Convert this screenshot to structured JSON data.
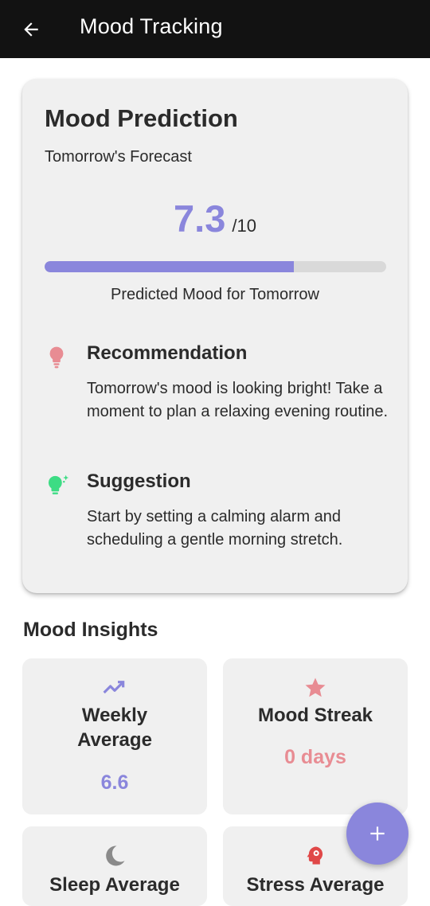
{
  "appbar": {
    "title": "Mood Tracking",
    "back_icon": "arrow-back-icon"
  },
  "prediction": {
    "title": "Mood Prediction",
    "subtitle": "Tomorrow's Forecast",
    "score": "7.3",
    "score_max": "/10",
    "progress_fraction": 0.73,
    "caption": "Predicted Mood for Tomorrow",
    "recommendation": {
      "icon": "lightbulb-icon",
      "heading": "Recommendation",
      "text": "Tomorrow's mood is looking bright! Take a moment to plan a relaxing evening routine."
    },
    "suggestion": {
      "icon": "lightbulb-sparkle-icon",
      "heading": "Suggestion",
      "text": "Start by setting a calming alarm and scheduling a gentle morning stretch."
    }
  },
  "insights": {
    "title": "Mood Insights",
    "tiles": [
      {
        "icon": "trending-up-icon",
        "label": "Weekly Average",
        "value": "6.6"
      },
      {
        "icon": "star-icon",
        "label": "Mood Streak",
        "value": "0 days"
      },
      {
        "icon": "moon-icon",
        "label": "Sleep Average",
        "value": ""
      },
      {
        "icon": "head-gear-icon",
        "label": "Stress Average",
        "value": ""
      }
    ]
  },
  "fab": {
    "icon": "plus-icon"
  },
  "colors": {
    "accent": "#8a86dc",
    "streak": "#e88c93",
    "bulb_pink": "#e88c93",
    "bulb_green": "#3ddc84",
    "stress_red": "#e04848",
    "moon_gray": "#8a8a8a"
  }
}
